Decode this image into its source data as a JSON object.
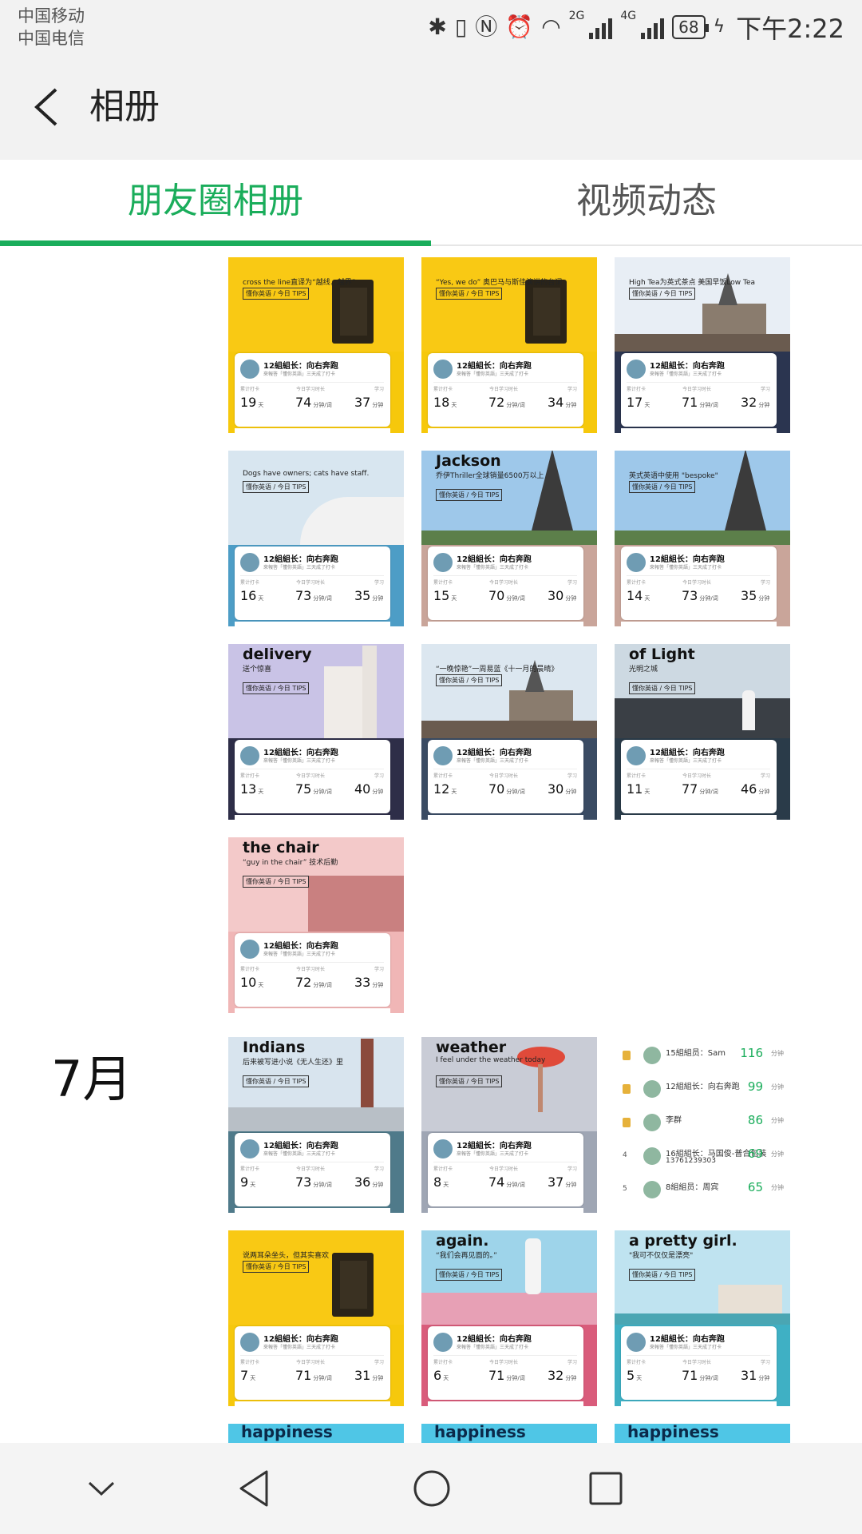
{
  "status_bar": {
    "carrier_1": "中国移动",
    "carrier_2": "中国电信",
    "net_2g": "2G",
    "net_4g": "4G",
    "battery": "68",
    "time": "下午2:22"
  },
  "app_bar": {
    "title": "相册"
  },
  "tabs": [
    {
      "label": "朋友圈相册",
      "active": true
    },
    {
      "label": "视频动态",
      "active": false
    }
  ],
  "month_label": "7月",
  "card_common": {
    "name": "12組組长：向右奔跑",
    "desc": "來報答「懂你英語」三天成了打卡",
    "label_1": "累计打卡",
    "label_2": "今日学习时长",
    "label_3": "学习",
    "unit_days": "天",
    "unit_words": "分钟/词",
    "unit_min": "分钟",
    "tag": "懂你英语 / 今日 TIPS"
  },
  "thumbnails": [
    {
      "headline": "",
      "sub": "cross the line直译为“越线，越界”",
      "c1": "#f9c914",
      "c2": "#f6c80c",
      "days": "19",
      "mid": "74",
      "right": "37",
      "theme": "film"
    },
    {
      "headline": "",
      "sub": "“Yes, we do” 奥巴马与斯佳演讲的台词",
      "c1": "#f9c914",
      "c2": "#f6c80c",
      "days": "18",
      "mid": "72",
      "right": "34",
      "theme": "film"
    },
    {
      "headline": "",
      "sub": "High Tea为英式茶点 美国早饭Low Tea",
      "c1": "#e8eef5",
      "c2": "#2b3550",
      "days": "17",
      "mid": "71",
      "right": "32",
      "theme": "cathedral"
    },
    {
      "headline": "",
      "sub": "Dogs have owners; cats have staff.",
      "c1": "#d8e6f0",
      "c2": "#4d9dc6",
      "days": "16",
      "mid": "73",
      "right": "35",
      "theme": "sea"
    },
    {
      "headline": "Jackson",
      "sub": "乔伊Thriller全球销量6500万以上",
      "c1": "#9ec8ea",
      "c2": "#c9a59a",
      "days": "15",
      "mid": "70",
      "right": "30",
      "theme": "eiffel"
    },
    {
      "headline": "",
      "sub": "英式英语中使用 \"bespoke\"",
      "c1": "#9ec8ea",
      "c2": "#c9a59a",
      "days": "14",
      "mid": "73",
      "right": "35",
      "theme": "eiffel"
    },
    {
      "headline": "delivery",
      "sub": "送个惊喜",
      "c1": "#c9c3e6",
      "c2": "#2e2e48",
      "days": "13",
      "mid": "75",
      "right": "40",
      "theme": "castle"
    },
    {
      "headline": "",
      "sub": "“一晚惊艳”一周易蓝《十一月的晨晴》",
      "c1": "#dce7f0",
      "c2": "#3a4b63",
      "days": "12",
      "mid": "70",
      "right": "30",
      "theme": "cathedral"
    },
    {
      "headline": "of Light",
      "sub": "光明之城",
      "c1": "#cdd9e2",
      "c2": "#2a3b49",
      "days": "11",
      "mid": "77",
      "right": "46",
      "theme": "beach"
    },
    {
      "headline": "the chair",
      "sub": "“guy in the chair” 技术后勤",
      "c1": "#f3c9c9",
      "c2": "#f0b6b6",
      "days": "10",
      "mid": "72",
      "right": "33",
      "theme": "palace"
    },
    {
      "headline": "Indians",
      "sub": "后来被写进小说《无人生还》里",
      "c1": "#d8e4ee",
      "c2": "#4f7a8a",
      "days": "9",
      "mid": "73",
      "right": "36",
      "theme": "venice"
    },
    {
      "headline": "weather",
      "sub": "I feel under the weather today",
      "c1": "#c9ccd6",
      "c2": "#9fa6b4",
      "days": "8",
      "mid": "74",
      "right": "37",
      "theme": "dancer"
    },
    {
      "headline": "",
      "sub": "说两耳朵坐头，但其实喜欢",
      "c1": "#f9c914",
      "c2": "#f6c80c",
      "days": "7",
      "mid": "71",
      "right": "31",
      "theme": "film"
    },
    {
      "headline": "again.",
      "sub": "“我们会再见面的。”",
      "c1": "#9ed4ea",
      "c2": "#d95c7b",
      "days": "6",
      "mid": "71",
      "right": "32",
      "theme": "jump"
    },
    {
      "headline": "a pretty girl.",
      "sub": "\"我可不仅仅是漂亮\"",
      "c1": "#bfe3f0",
      "c2": "#3fb0c4",
      "days": "5",
      "mid": "71",
      "right": "31",
      "theme": "harbor"
    }
  ],
  "ranking": [
    {
      "name": "15組組员：Sam",
      "sub": "",
      "value": "116",
      "unit": "分钟",
      "rank": ""
    },
    {
      "name": "12組組长：向右奔跑",
      "sub": "",
      "value": "99",
      "unit": "分钟",
      "rank": ""
    },
    {
      "name": "李群",
      "sub": "",
      "value": "86",
      "unit": "分钟",
      "rank": ""
    },
    {
      "name": "16組組长：马国俊-普合包装",
      "sub": "13761239303",
      "value": "69",
      "unit": "分钟",
      "rank": "4"
    },
    {
      "name": "8組組员：周宾",
      "sub": "",
      "value": "65",
      "unit": "分钟",
      "rank": "5"
    }
  ],
  "peek_row": [
    "happiness",
    "happiness",
    "happiness"
  ]
}
